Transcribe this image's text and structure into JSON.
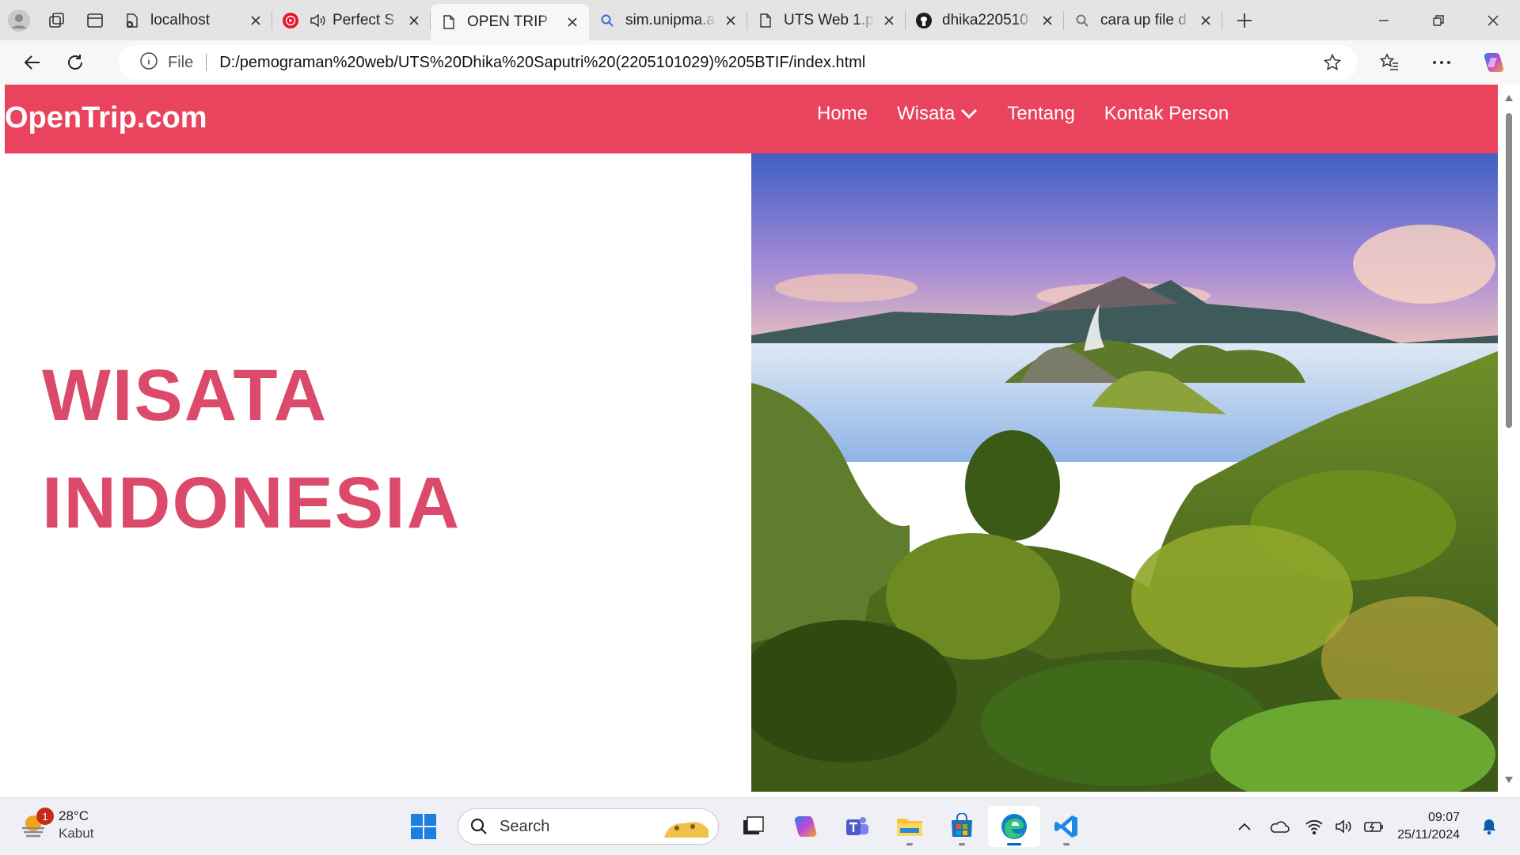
{
  "tabs": [
    {
      "title": "localhost",
      "icon": "page-error-icon"
    },
    {
      "title": "Perfect S",
      "icon": "youtube-music-icon"
    },
    {
      "title": "OPEN TRIP",
      "icon": "document-icon"
    },
    {
      "title": "sim.unipma.a",
      "icon": "search-icon"
    },
    {
      "title": "UTS Web 1.p",
      "icon": "document-icon"
    },
    {
      "title": "dhika220510",
      "icon": "github-icon"
    },
    {
      "title": "cara up file d",
      "icon": "search-icon"
    }
  ],
  "address": {
    "scheme_label": "File",
    "url": "D:/pemograman%20web/UTS%20Dhika%20Saputri%20(2205101029)%205BTIF/index.html"
  },
  "site": {
    "brand": "OpenTrip.com",
    "nav": [
      "Home",
      "Wisata",
      "Tentang",
      "Kontak Person"
    ],
    "hero_line1": "WISATA",
    "hero_line2": "INDONESIA"
  },
  "taskbar": {
    "weather_temp": "28°C",
    "weather_desc": "Kabut",
    "weather_badge": "1",
    "search_placeholder": "Search",
    "time": "09:07",
    "date": "25/11/2024"
  },
  "colors": {
    "nav_bg": "#ea435e",
    "hero_text": "#dc4a6b"
  }
}
